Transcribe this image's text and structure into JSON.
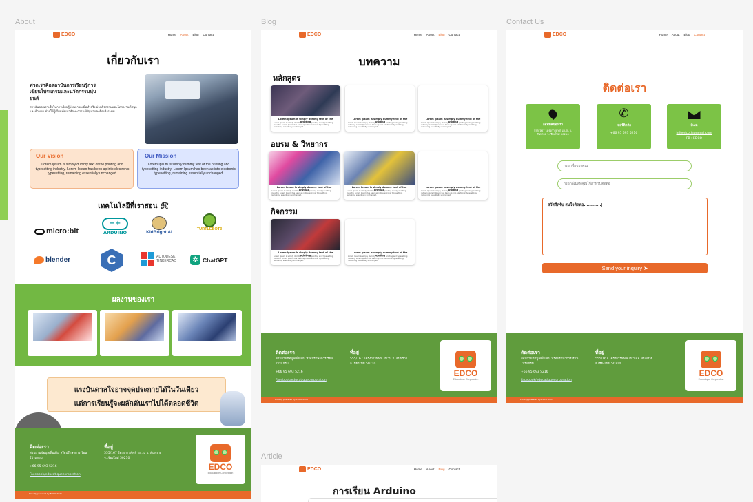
{
  "frames": {
    "about": "About",
    "blog": "Blog",
    "contact": "Contact Us",
    "article": "Article"
  },
  "nav": {
    "logo": "EDCO",
    "links": [
      "Home",
      "About",
      "Blog",
      "Contact"
    ]
  },
  "about": {
    "title": "เกี่ยวกับเรา",
    "intro_heading": "พวกเราคือสถาบันการเรียนรู้การเขียนโปรแกรมและนวัตกรรมหุ่นยนต์",
    "intro_text": "สถาบันของเราเชื่อในการเรียนรู้ผ่านการลงมือทำจริง ผ่านกิจกรรมและโครงงานที่สนุกและท้าทาย ช่วยให้ผู้เรียนพัฒนาทักษะการแก้ปัญหาและคิดเชิงระบบ",
    "vision_title": "Our Vision",
    "vision_text": "Lorem Ipsum is simply dummy text of the printing and typesetting industry. Lorem Ipsum has been ap into electronic typesetting, remaining essentially unchanged.",
    "mission_title": "Our Mission",
    "mission_text": "Lorem Ipsum is simply dummy text of the printing and typesetting industry. Lorem Ipsum has been ap into electronic typesetting, remaining essentially unchanged.",
    "tech_title": "เทคโนโลยีที่เราสอน 🛠",
    "tech": [
      "micro:bit",
      "ARDUINO",
      "KidBright AI",
      "TURTLEBOT3",
      "blender",
      "C",
      "AUTODESK TINKERCAD",
      "ChatGPT"
    ],
    "works_title": "ผลงานของเรา",
    "quote_line1": "แรงบันดาลใจอาจจุดประกายได้ในวันเดียว",
    "quote_line2": "แต่การเรียนรู้จะผลักดันเราไปได้ตลอดชีวิต"
  },
  "blog": {
    "title": "บทความ",
    "sections": [
      "หลักสูตร",
      "อบรม & วิทยากร",
      "กิจกรรม"
    ],
    "card_title": "Lorem Ipsum is simply dummy text of the printing",
    "card_body": "Lorem Ipsum is simply dummy text of the printing and typesetting industry. Lorem Ipsum has been ap into electronic typesetting, remaining essentially unchanged."
  },
  "contact": {
    "title": "ติดต่อเรา",
    "boxes": [
      {
        "label": "ออฟฟิศของเรา",
        "value": "555/167 โครงการพัฟฟ์ เฮเว่น อ. สันทราย จ.เชียงใหม่ 50210"
      },
      {
        "label": "เบอร์ติดต่อ",
        "value": "+66 95 693 5216"
      },
      {
        "label": "อีเมล",
        "value": "infoedcoth@gmail.com",
        "value2": "FB : EDCO"
      }
    ],
    "name_placeholder": "กรอกชื่อของคุณ",
    "contact_placeholder": "กรอกอีเมลที่คุณใช้สำหรับติดต่อ",
    "message": "สวัสดีครับ สนใจติดต่อ............|",
    "send": "Send your inquiry"
  },
  "footer": {
    "contact_title": "ติดต่อเรา",
    "contact_text": "สอบถามข้อมูลเพิ่มเติม หรือปรึกษาการเรียนโปรแกรม",
    "phone": "+66 95 693 5216",
    "fb": "Facebook/educatiquecorporation",
    "address_title": "ที่อยู่",
    "address": "555/167 โครงการพัฟฟ์ เฮเว่น อ. สันทราย จ.เชียงใหม่ 50210",
    "logo_word": "EDCO",
    "logo_sub": "Educatique Corporation",
    "strip": "Proudly powered by EDCO 2025"
  },
  "article": {
    "title": "การเรียน Arduino"
  }
}
